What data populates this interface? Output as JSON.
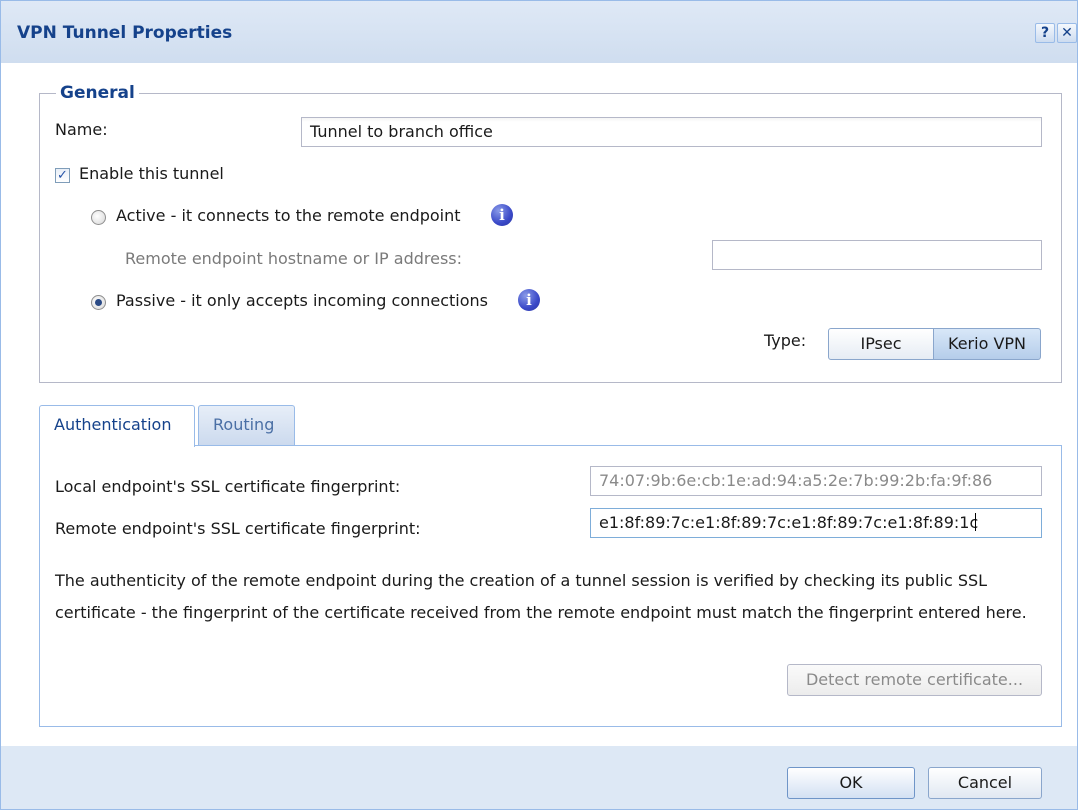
{
  "dialog": {
    "title": "VPN Tunnel Properties",
    "help_label": "?",
    "close_label": "✕"
  },
  "general": {
    "legend": "General",
    "name_label": "Name:",
    "name_value": "Tunnel to branch office",
    "enable_label": "Enable this tunnel",
    "enable_checked": true,
    "active_label": "Active - it connects to the remote endpoint",
    "remote_host_label": "Remote endpoint hostname or IP address:",
    "remote_host_value": "",
    "passive_label": "Passive - it only accepts incoming connections",
    "mode_selected": "passive",
    "info_glyph": "i",
    "type_label": "Type:",
    "type_options": [
      "IPsec",
      "Kerio VPN"
    ],
    "type_selected": "Kerio VPN"
  },
  "tabs": [
    {
      "label": "Authentication",
      "active": true
    },
    {
      "label": "Routing",
      "active": false
    }
  ],
  "authentication": {
    "local_label": "Local endpoint's SSL certificate fingerprint:",
    "local_value": "74:07:9b:6e:cb:1e:ad:94:a5:2e:7b:99:2b:fa:9f:86",
    "remote_label": "Remote endpoint's SSL certificate fingerprint:",
    "remote_value": "e1:8f:89:7c:e1:8f:89:7c:e1:8f:89:7c:e1:8f:89:1c",
    "description": "The authenticity of the remote endpoint during the creation of a tunnel session is verified by checking its public SSL certificate - the fingerprint of the certificate received from the remote endpoint must match the fingerprint entered here.",
    "detect_button": "Detect remote certificate..."
  },
  "footer": {
    "ok_label": "OK",
    "cancel_label": "Cancel"
  },
  "icons": {
    "checkbox": "checkbox-checked-icon",
    "info": "info-icon",
    "help": "help-icon",
    "close": "close-icon"
  },
  "colors": {
    "title": "#15428b",
    "frame": "#dde8f5",
    "border": "#99bbe8",
    "info_icon": "#3a49c8"
  }
}
